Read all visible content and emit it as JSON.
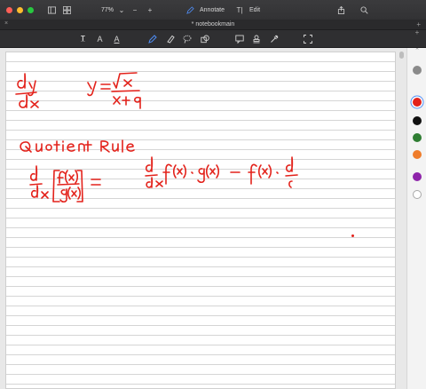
{
  "window": {
    "zoom": "77%",
    "annotate_label": "Annotate",
    "edit_label": "Edit",
    "traffic_colors": [
      "#ff5f57",
      "#febc2e",
      "#28c840"
    ]
  },
  "tabbar": {
    "title": "* notebookmain",
    "close_glyph": "×",
    "add_glyph": "+"
  },
  "palette": {
    "colors": [
      "#8a8a8a",
      "#e3221b",
      "#111111",
      "#2e7d32",
      "#ef7c2a",
      "#8e24aa",
      "#ffffff"
    ]
  },
  "colors": {
    "ink": "#e3221b",
    "annotate": "#4f8ef7"
  }
}
